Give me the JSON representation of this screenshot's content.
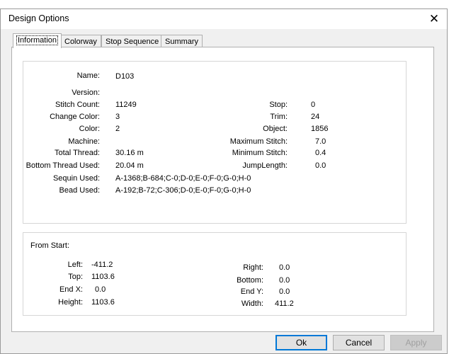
{
  "window": {
    "title": "Design Options",
    "close_glyph": "✕"
  },
  "tabs": [
    {
      "label": "Information",
      "active": true
    },
    {
      "label": "Colorway",
      "active": false
    },
    {
      "label": "Stop Sequence",
      "active": false
    },
    {
      "label": "Summary",
      "active": false
    }
  ],
  "info": {
    "name": {
      "label": "Name:",
      "value": "D103"
    },
    "version": {
      "label": "Version:",
      "value": ""
    },
    "stitch_count": {
      "label": "Stitch Count:",
      "value": "11249"
    },
    "change_color": {
      "label": "Change Color:",
      "value": "3"
    },
    "color": {
      "label": "Color:",
      "value": "2"
    },
    "machine": {
      "label": "Machine:",
      "value": ""
    },
    "total_thread": {
      "label": "Total Thread:",
      "value": "30.16 m"
    },
    "bottom_thread": {
      "label": "Bottom Thread Used:",
      "value": "20.04 m"
    },
    "sequin_used": {
      "label": "Sequin Used:",
      "value": "A-1368;B-684;C-0;D-0;E-0;F-0;G-0;H-0"
    },
    "bead_used": {
      "label": "Bead Used:",
      "value": "A-192;B-72;C-306;D-0;E-0;F-0;G-0;H-0"
    },
    "stop": {
      "label": "Stop:",
      "value": "0"
    },
    "trim": {
      "label": "Trim:",
      "value": "24"
    },
    "object": {
      "label": "Object:",
      "value": "1856"
    },
    "max_stitch": {
      "label": "Maximum Stitch:",
      "value": "7.0"
    },
    "min_stitch": {
      "label": "Minimum Stitch:",
      "value": "0.4"
    },
    "jump_length": {
      "label": "JumpLength:",
      "value": "0.0"
    }
  },
  "from_start": {
    "heading": "From Start:",
    "left": {
      "label": "Left:",
      "value": "-411.2"
    },
    "top": {
      "label": "Top:",
      "value": "1103.6"
    },
    "end_x": {
      "label": "End X:",
      "value": "0.0"
    },
    "height": {
      "label": "Height:",
      "value": "1103.6"
    },
    "right": {
      "label": "Right:",
      "value": "0.0"
    },
    "bottom": {
      "label": "Bottom:",
      "value": "0.0"
    },
    "end_y": {
      "label": "End Y:",
      "value": "0.0"
    },
    "width": {
      "label": "Width:",
      "value": "411.2"
    }
  },
  "buttons": {
    "ok": "Ok",
    "cancel": "Cancel",
    "apply": "Apply"
  }
}
